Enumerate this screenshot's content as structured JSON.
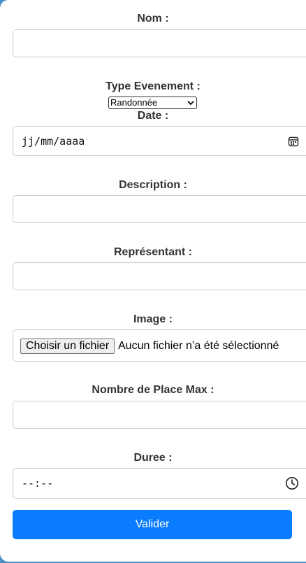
{
  "form": {
    "nom": {
      "label": "Nom :",
      "value": ""
    },
    "type_evenement": {
      "label": "Type Evenement :",
      "selected": "Randonnée"
    },
    "date": {
      "label": "Date :",
      "placeholder": "jj/mm/aaaa"
    },
    "description": {
      "label": "Description :",
      "value": ""
    },
    "representant": {
      "label": "Représentant :",
      "value": ""
    },
    "image": {
      "label": "Image :",
      "button_label": "Choisir un fichier",
      "status": "Aucun fichier n’a été sélectionné"
    },
    "nombre_place_max": {
      "label": "Nombre de Place Max :",
      "value": ""
    },
    "duree": {
      "label": "Duree :",
      "placeholder": "--:--"
    },
    "submit_label": "Valider"
  },
  "icons": {
    "date": "calendar-icon",
    "time": "clock-icon",
    "select": "chevron-down-icon"
  },
  "colors": {
    "accent": "#0a7cff",
    "label_text": "#333333",
    "border": "#cccccc",
    "background": "#4a90c8"
  }
}
